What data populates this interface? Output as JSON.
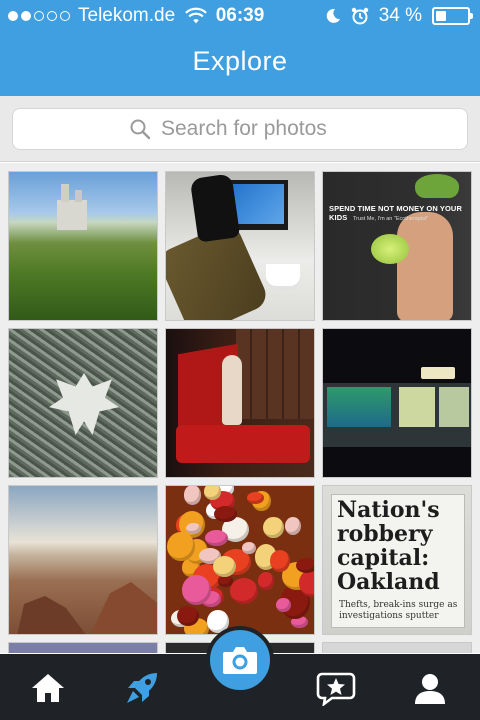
{
  "status_bar": {
    "signal_dots": 5,
    "signal_filled": 2,
    "carrier": "Telekom.de",
    "time": "06:39",
    "battery_percent": "34 %",
    "battery_level": 0.34
  },
  "header": {
    "title": "Explore"
  },
  "search": {
    "placeholder": "Search for photos",
    "icon": "search-icon"
  },
  "photo_grid": {
    "tiles": [
      {
        "subject": "castle-landscape"
      },
      {
        "subject": "office-desk-shoes"
      },
      {
        "subject": "kid-melon-poster",
        "text": "SPEND TIME NOT MONEY ON YOUR KIDS",
        "subtext": "Trust Me, I'm an \"Ecotherapist\""
      },
      {
        "subject": "frosted-leaf"
      },
      {
        "subject": "child-red-flag"
      },
      {
        "subject": "control-panel-screens"
      },
      {
        "subject": "canyon-sky"
      },
      {
        "subject": "candy-closeup"
      },
      {
        "subject": "newspaper-headline",
        "headline": "Nation's robbery capital: Oakland",
        "subhead": "Thefts, break-ins surge as investigations sputter"
      }
    ]
  },
  "tab_bar": {
    "items": [
      {
        "name": "home",
        "icon": "home-icon",
        "active": false
      },
      {
        "name": "explore",
        "icon": "rocket-icon",
        "active": true
      },
      {
        "name": "camera",
        "icon": "camera-icon",
        "active": false
      },
      {
        "name": "activity",
        "icon": "star-chat-icon",
        "active": false
      },
      {
        "name": "profile",
        "icon": "user-icon",
        "active": false
      }
    ],
    "accent": "#3f9fe0",
    "background": "#1f2327"
  },
  "colors": {
    "header_blue": "#3f9fe0",
    "search_bg": "#e9e9ea",
    "tab_bar": "#1f2327"
  }
}
